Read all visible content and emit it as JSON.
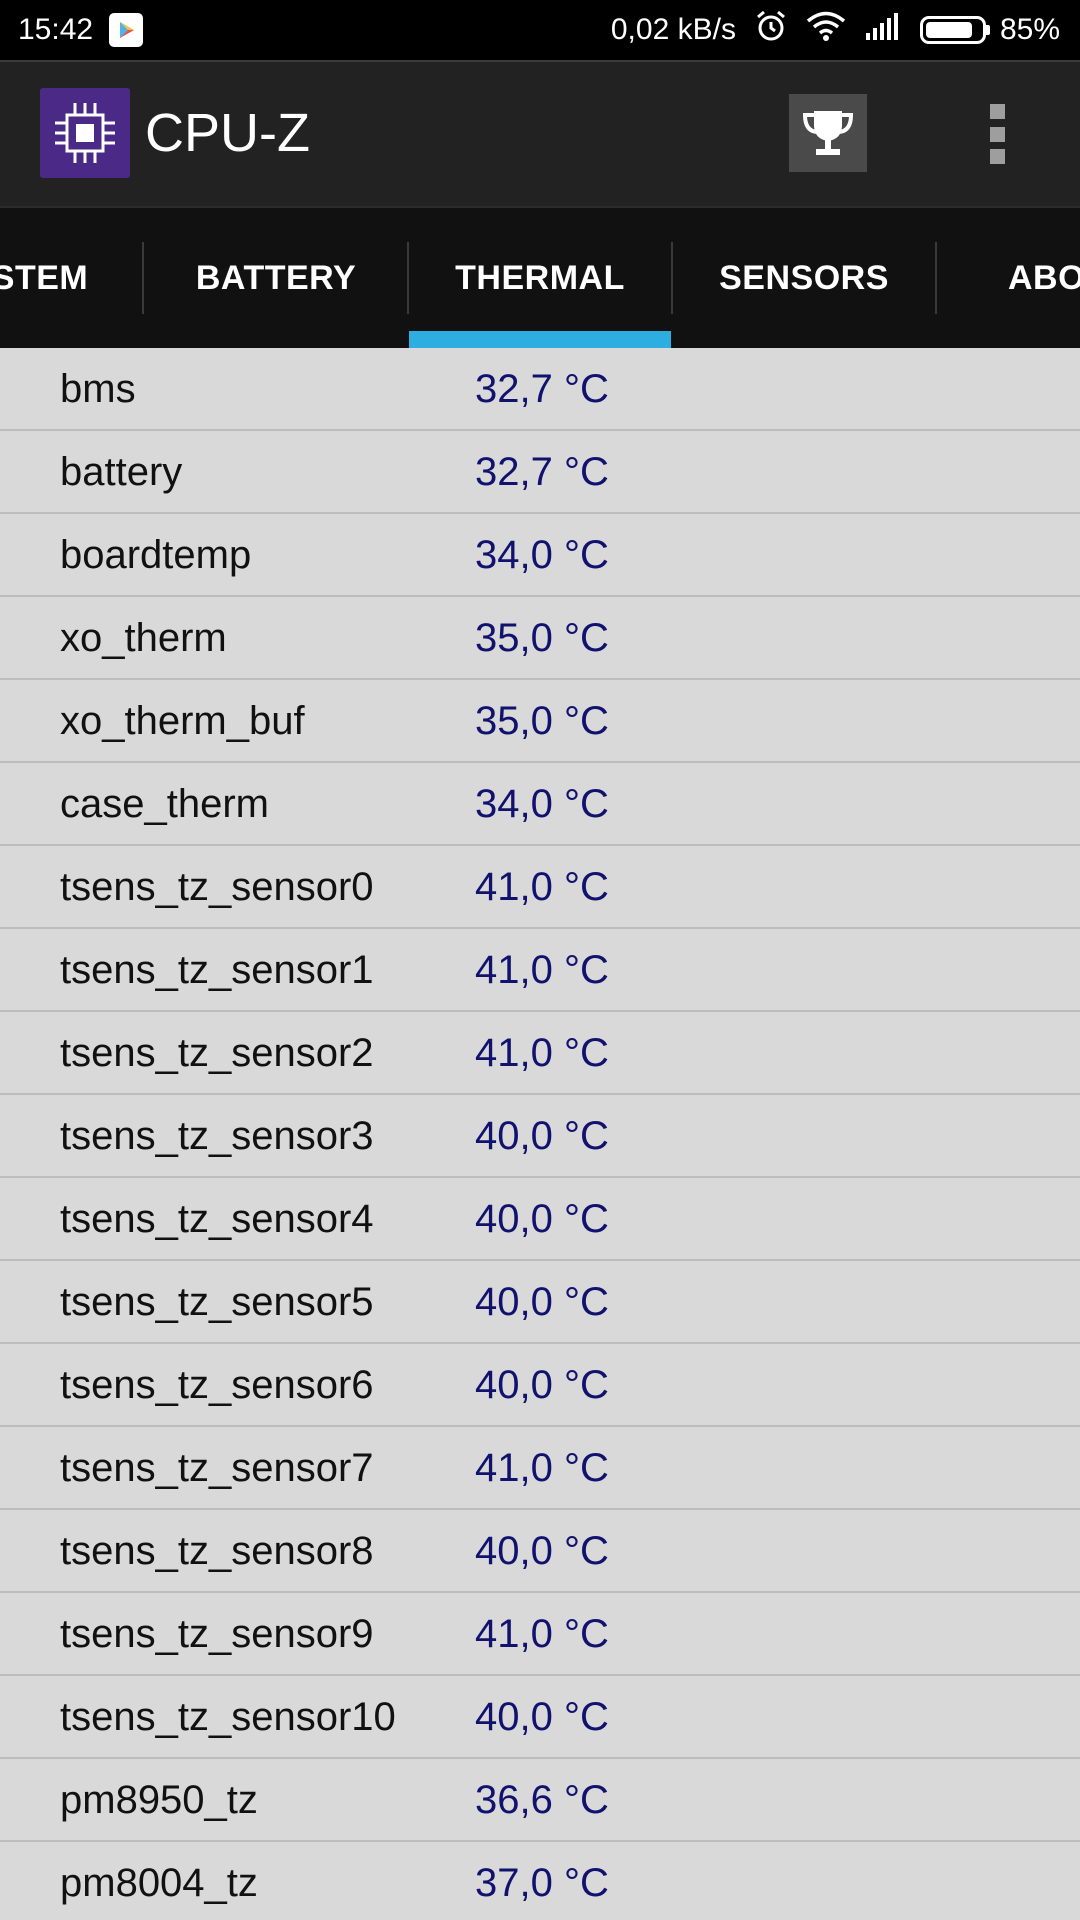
{
  "status_bar": {
    "time": "15:42",
    "network_speed": "0,02 kB/s",
    "battery_percent": "85%",
    "battery_level": 0.85,
    "icons": [
      "play-store-icon",
      "alarm-icon",
      "wifi-icon",
      "signal-icon",
      "battery-icon"
    ]
  },
  "app_bar": {
    "title": "CPU-Z",
    "logo_icon": "cpu-chip-icon",
    "actions": [
      "trophy-icon",
      "overflow-menu-icon"
    ]
  },
  "tabs": [
    {
      "label": "STEM",
      "selected": false
    },
    {
      "label": "BATTERY",
      "selected": false
    },
    {
      "label": "THERMAL",
      "selected": true
    },
    {
      "label": "SENSORS",
      "selected": false
    },
    {
      "label": "ABO",
      "selected": false
    }
  ],
  "colors": {
    "accent": "#2eaee0",
    "value_text": "#10126e",
    "background": "#d9d9d9",
    "app_bar": "#222222",
    "logo": "#4a2a86"
  },
  "thermal": {
    "rows": [
      {
        "name": "bms",
        "value": "32,7 °C"
      },
      {
        "name": "battery",
        "value": "32,7 °C"
      },
      {
        "name": "boardtemp",
        "value": "34,0 °C"
      },
      {
        "name": "xo_therm",
        "value": "35,0 °C"
      },
      {
        "name": "xo_therm_buf",
        "value": "35,0 °C"
      },
      {
        "name": "case_therm",
        "value": "34,0 °C"
      },
      {
        "name": "tsens_tz_sensor0",
        "value": "41,0 °C"
      },
      {
        "name": "tsens_tz_sensor1",
        "value": "41,0 °C"
      },
      {
        "name": "tsens_tz_sensor2",
        "value": "41,0 °C"
      },
      {
        "name": "tsens_tz_sensor3",
        "value": "40,0 °C"
      },
      {
        "name": "tsens_tz_sensor4",
        "value": "40,0 °C"
      },
      {
        "name": "tsens_tz_sensor5",
        "value": "40,0 °C"
      },
      {
        "name": "tsens_tz_sensor6",
        "value": "40,0 °C"
      },
      {
        "name": "tsens_tz_sensor7",
        "value": "41,0 °C"
      },
      {
        "name": "tsens_tz_sensor8",
        "value": "40,0 °C"
      },
      {
        "name": "tsens_tz_sensor9",
        "value": "41,0 °C"
      },
      {
        "name": "tsens_tz_sensor10",
        "value": "40,0 °C"
      },
      {
        "name": "pm8950_tz",
        "value": "36,6 °C"
      },
      {
        "name": "pm8004_tz",
        "value": "37,0 °C"
      }
    ]
  }
}
